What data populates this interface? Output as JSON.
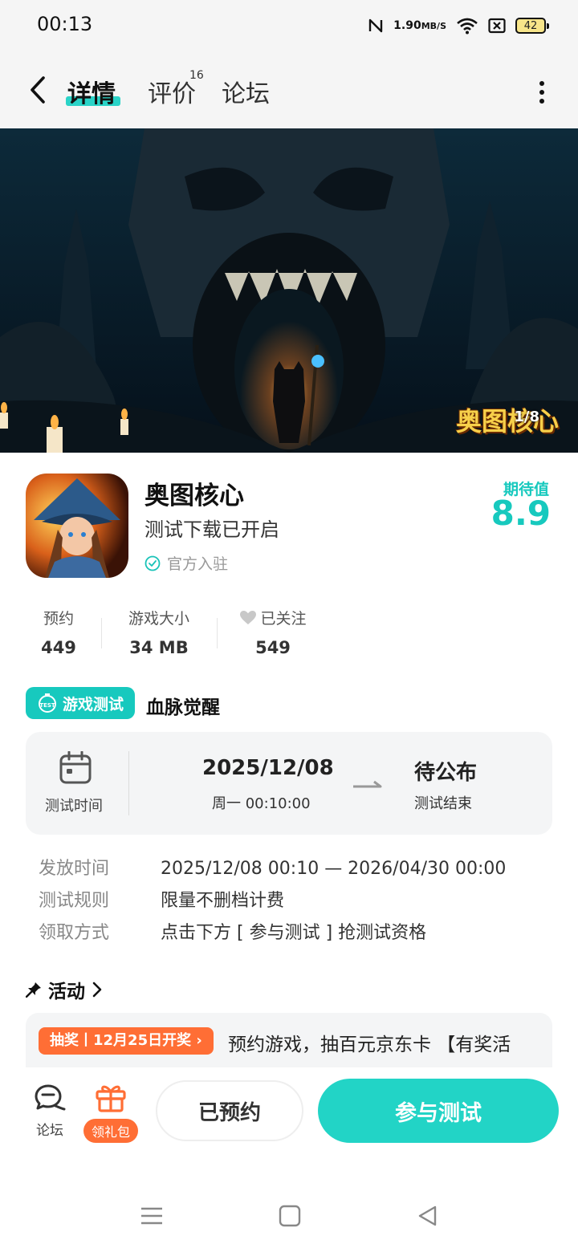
{
  "status_bar": {
    "time": "00:13",
    "net_speed_value": "1.90",
    "net_speed_unit": "MB/S",
    "battery": "42",
    "icons": [
      "nfc-icon",
      "wifi-icon",
      "sim-off-icon",
      "battery-icon"
    ]
  },
  "header": {
    "tabs": [
      {
        "label": "详情",
        "active": true
      },
      {
        "label": "评价",
        "badge": "16"
      },
      {
        "label": "论坛"
      }
    ]
  },
  "banner": {
    "logo_text": "奥图核心",
    "counter": "1/8"
  },
  "app": {
    "name": "奥图核心",
    "subtitle": "测试下载已开启",
    "official": "官方入驻",
    "expect_label": "期待值",
    "expect_value": "8.9"
  },
  "stats": [
    {
      "label": "预约",
      "value": "449"
    },
    {
      "label": "游戏大小",
      "value": "34 MB"
    },
    {
      "label": "已关注",
      "value": "549"
    }
  ],
  "test": {
    "badge": "游戏测试",
    "badge_icon_text": "TEST",
    "name": "血脉觉醒",
    "time_label": "测试时间",
    "start_date": "2025/12/08",
    "start_weekday": "周一  00:10:00",
    "end_value": "待公布",
    "end_label": "测试结束"
  },
  "details": [
    {
      "key": "发放时间",
      "value": "2025/12/08 00:10 — 2026/04/30 00:00"
    },
    {
      "key": "测试规则",
      "value": "限量不删档计费"
    },
    {
      "key": "领取方式",
      "value": "点击下方 [ 参与测试 ] 抢测试资格"
    }
  ],
  "activities": {
    "title": "活动",
    "pill": "抽奖丨12月25日开奖",
    "text": "预约游戏，抽百元京东卡 【有奖活"
  },
  "bottom_bar": {
    "forum_label": "论坛",
    "gift_label": "领礼包",
    "reserved_label": "已预约",
    "join_label": "参与测试"
  },
  "colors": {
    "accent": "#22d4c6",
    "orange": "#ff6e35",
    "card_bg": "#f4f5f6"
  }
}
